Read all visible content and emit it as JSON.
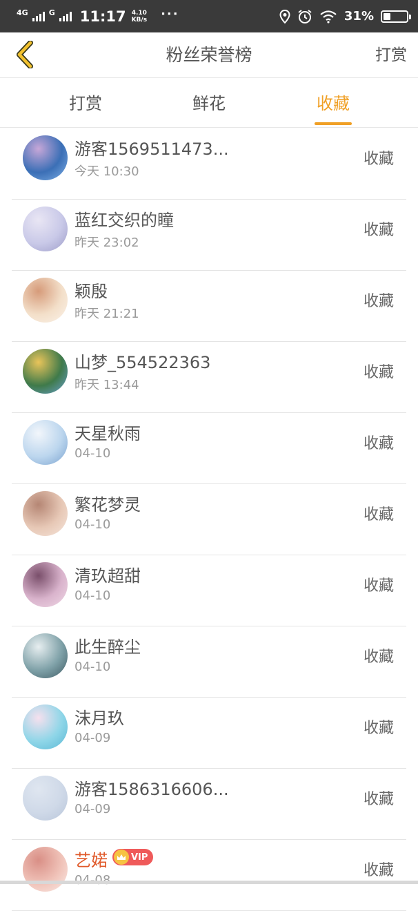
{
  "status_bar": {
    "network_1": "4G",
    "network_2": "G",
    "time": "11:17",
    "speed_value": "4.10",
    "speed_unit": "KB/s",
    "more": "···",
    "battery": "31%",
    "battery_level": 0.31
  },
  "header": {
    "title": "粉丝荣誉榜",
    "action": "打赏",
    "back_icon": "chevron-left-icon"
  },
  "tabs": [
    {
      "label": "打赏",
      "active": false
    },
    {
      "label": "鲜花",
      "active": false
    },
    {
      "label": "收藏",
      "active": true
    }
  ],
  "colors": {
    "accent": "#f0a026",
    "text": "#555555",
    "muted": "#9a9a9a",
    "vip_name": "#e05a2b",
    "status_bar": "#3a3a3a"
  },
  "fans": [
    {
      "name": "游客1569511473...",
      "time": "今天 10:30",
      "action": "收藏",
      "colors": [
        "#3b6fb6",
        "#c7a7d8",
        "#7fb0e6"
      ]
    },
    {
      "name": "蓝红交织的瞳",
      "time": "昨天 23:02",
      "action": "收藏",
      "colors": [
        "#c9c9e8",
        "#e9e6f4",
        "#9d9cc8"
      ]
    },
    {
      "name": "颖殷",
      "time": "昨天 21:21",
      "action": "收藏",
      "colors": [
        "#f3dfc9",
        "#d69b7a",
        "#fbf3ea"
      ]
    },
    {
      "name": "山梦_554522363",
      "time": "昨天 13:44",
      "action": "收藏",
      "colors": [
        "#3f7a4a",
        "#e9c45a",
        "#6aa0d0"
      ]
    },
    {
      "name": "天星秋雨",
      "time": "04-10",
      "action": "收藏",
      "colors": [
        "#bcd6ee",
        "#f2f6fb",
        "#7aa2cf"
      ]
    },
    {
      "name": "繁花梦灵",
      "time": "04-10",
      "action": "收藏",
      "colors": [
        "#e7c8b6",
        "#b58674",
        "#f6e6dc"
      ]
    },
    {
      "name": "清玖超甜",
      "time": "04-10",
      "action": "收藏",
      "colors": [
        "#d9b3cc",
        "#7a4f6b",
        "#f0d9e6"
      ]
    },
    {
      "name": "此生醉尘",
      "time": "04-10",
      "action": "收藏",
      "colors": [
        "#7fa1a8",
        "#e7eef0",
        "#3d5a63"
      ]
    },
    {
      "name": "沫月玖",
      "time": "04-09",
      "action": "收藏",
      "colors": [
        "#8fd6e8",
        "#f6e0ee",
        "#5ab7d4"
      ]
    },
    {
      "name": "游客1586316606...",
      "time": "04-09",
      "action": "收藏",
      "colors": [
        "#cfd9e8",
        "#dfe6f0",
        "#b9c6da"
      ]
    },
    {
      "name": "艺婼",
      "time": "04-08",
      "action": "收藏",
      "vip": "VIP",
      "colors": [
        "#f0c3b9",
        "#d98f86",
        "#faeae6"
      ]
    }
  ]
}
